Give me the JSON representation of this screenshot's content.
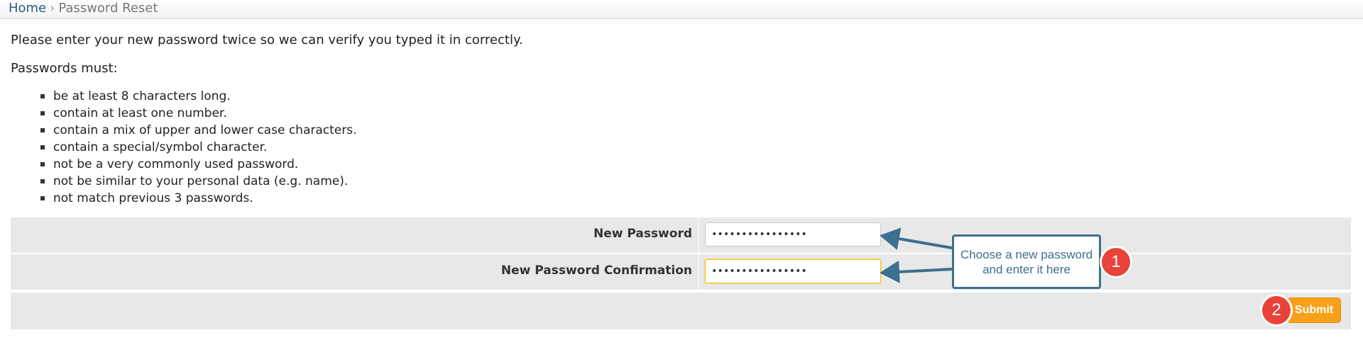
{
  "breadcrumb": {
    "home": "Home",
    "separator": "›",
    "current": "Password Reset"
  },
  "intro": "Please enter your new password twice so we can verify you typed it in correctly.",
  "must_heading": "Passwords must:",
  "rules": [
    "be at least 8 characters long.",
    "contain at least one number.",
    "contain a mix of upper and lower case characters.",
    "contain a special/symbol character.",
    "not be a very commonly used password.",
    "not be similar to your personal data (e.g. name).",
    "not match previous 3 passwords."
  ],
  "form": {
    "new_password_label": "New Password",
    "new_password_value": "••••••••••••••••",
    "confirm_label": "New Password Confirmation",
    "confirm_value": "••••••••••••••••",
    "submit_label": "Submit"
  },
  "annotation": {
    "callout_text": "Choose a new password and enter it here",
    "step1": "1",
    "step2": "2",
    "badge_color": "#e8423a",
    "callout_color": "#3d6f8e"
  },
  "colors": {
    "accent": "#f7a11a",
    "link": "#2a5a8a",
    "row_bg": "#e8e8e8"
  }
}
